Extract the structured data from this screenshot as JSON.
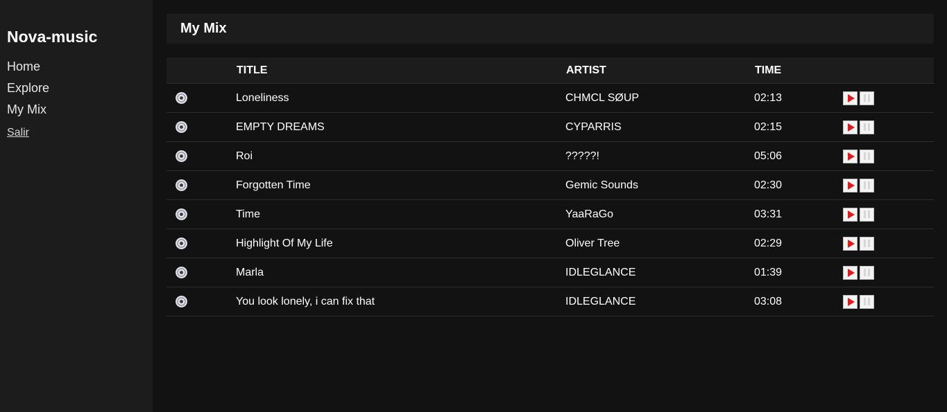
{
  "sidebar": {
    "brand": "Nova-music",
    "items": [
      {
        "label": "Home"
      },
      {
        "label": "Explore"
      },
      {
        "label": "My Mix"
      }
    ],
    "logout_label": "Salir"
  },
  "main": {
    "title": "My Mix",
    "columns": {
      "title": "TITLE",
      "artist": "ARTIST",
      "time": "TIME"
    },
    "tracks": [
      {
        "title": "Loneliness",
        "artist": "CHMCL SØUP",
        "time": "02:13"
      },
      {
        "title": "EMPTY DREAMS",
        "artist": "CYPARRIS",
        "time": "02:15"
      },
      {
        "title": "Roi",
        "artist": "?????!",
        "time": "05:06"
      },
      {
        "title": "Forgotten Time",
        "artist": "Gemic Sounds",
        "time": "02:30"
      },
      {
        "title": "Time",
        "artist": "YaaRaGo",
        "time": "03:31"
      },
      {
        "title": "Highlight Of My Life",
        "artist": "Oliver Tree",
        "time": "02:29"
      },
      {
        "title": "Marla",
        "artist": "IDLEGLANCE",
        "time": "01:39"
      },
      {
        "title": "You look lonely, i can fix that",
        "artist": "IDLEGLANCE",
        "time": "03:08"
      }
    ]
  },
  "icons": {
    "track": "disc-icon",
    "play": "play-icon",
    "pause": "pause-icon"
  },
  "colors": {
    "background": "#121212",
    "panel": "#1c1c1c",
    "play_accent": "#e01b1b"
  }
}
